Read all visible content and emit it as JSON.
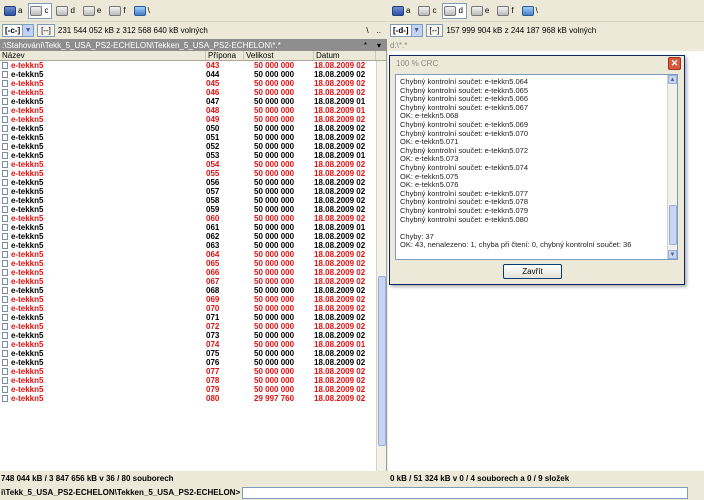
{
  "left": {
    "drives": [
      {
        "letter": "a",
        "type": "floppy"
      },
      {
        "letter": "c",
        "type": "hdd",
        "active": true
      },
      {
        "letter": "d",
        "type": "hdd"
      },
      {
        "letter": "e",
        "type": "hdd"
      },
      {
        "letter": "f",
        "type": "hdd"
      },
      {
        "letter": "\\",
        "type": "net"
      }
    ],
    "drive_combo": "[-c-]",
    "root_btn": "[--]",
    "free_space": "231 544 052 kB z 312 568 640 kB volných",
    "nav_back": "\\",
    "nav_up": "..",
    "path": ":\\Stahování\\Tekk_5_USA_PS2-ECHELON\\Tekken_5_USA_PS2-ECHELON\\*.*",
    "path_btn_star": "*",
    "path_btn_down": "▾",
    "columns": {
      "name": "Název",
      "ext": "Přípona",
      "size": "Velikost",
      "date": "Datum"
    },
    "rows": [
      {
        "name": "e-tekkn5",
        "ext": "043",
        "size": "50 000 000",
        "date": "18.08.2009 02",
        "color": "red"
      },
      {
        "name": "e-tekkn5",
        "ext": "044",
        "size": "50 000 000",
        "date": "18.08.2009 02",
        "color": "black"
      },
      {
        "name": "e-tekkn5",
        "ext": "045",
        "size": "50 000 000",
        "date": "18.08.2009 02",
        "color": "red"
      },
      {
        "name": "e-tekkn5",
        "ext": "046",
        "size": "50 000 000",
        "date": "18.08.2009 02",
        "color": "red"
      },
      {
        "name": "e-tekkn5",
        "ext": "047",
        "size": "50 000 000",
        "date": "18.08.2009 01",
        "color": "black"
      },
      {
        "name": "e-tekkn5",
        "ext": "048",
        "size": "50 000 000",
        "date": "18.08.2009 01",
        "color": "red"
      },
      {
        "name": "e-tekkn5",
        "ext": "049",
        "size": "50 000 000",
        "date": "18.08.2009 02",
        "color": "red"
      },
      {
        "name": "e-tekkn5",
        "ext": "050",
        "size": "50 000 000",
        "date": "18.08.2009 02",
        "color": "black"
      },
      {
        "name": "e-tekkn5",
        "ext": "051",
        "size": "50 000 000",
        "date": "18.08.2009 02",
        "color": "black"
      },
      {
        "name": "e-tekkn5",
        "ext": "052",
        "size": "50 000 000",
        "date": "18.08.2009 02",
        "color": "black"
      },
      {
        "name": "e-tekkn5",
        "ext": "053",
        "size": "50 000 000",
        "date": "18.08.2009 01",
        "color": "black"
      },
      {
        "name": "e-tekkn5",
        "ext": "054",
        "size": "50 000 000",
        "date": "18.08.2009 02",
        "color": "red"
      },
      {
        "name": "e-tekkn5",
        "ext": "055",
        "size": "50 000 000",
        "date": "18.08.2009 02",
        "color": "red"
      },
      {
        "name": "e-tekkn5",
        "ext": "056",
        "size": "50 000 000",
        "date": "18.08.2009 02",
        "color": "black"
      },
      {
        "name": "e-tekkn5",
        "ext": "057",
        "size": "50 000 000",
        "date": "18.08.2009 02",
        "color": "black"
      },
      {
        "name": "e-tekkn5",
        "ext": "058",
        "size": "50 000 000",
        "date": "18.08.2009 02",
        "color": "black"
      },
      {
        "name": "e-tekkn5",
        "ext": "059",
        "size": "50 000 000",
        "date": "18.08.2009 02",
        "color": "black"
      },
      {
        "name": "e-tekkn5",
        "ext": "060",
        "size": "50 000 000",
        "date": "18.08.2009 02",
        "color": "red"
      },
      {
        "name": "e-tekkn5",
        "ext": "061",
        "size": "50 000 000",
        "date": "18.08.2009 01",
        "color": "black"
      },
      {
        "name": "e-tekkn5",
        "ext": "062",
        "size": "50 000 000",
        "date": "18.08.2009 02",
        "color": "black"
      },
      {
        "name": "e-tekkn5",
        "ext": "063",
        "size": "50 000 000",
        "date": "18.08.2009 02",
        "color": "black"
      },
      {
        "name": "e-tekkn5",
        "ext": "064",
        "size": "50 000 000",
        "date": "18.08.2009 02",
        "color": "red"
      },
      {
        "name": "e-tekkn5",
        "ext": "065",
        "size": "50 000 000",
        "date": "18.08.2009 02",
        "color": "red"
      },
      {
        "name": "e-tekkn5",
        "ext": "066",
        "size": "50 000 000",
        "date": "18.08.2009 02",
        "color": "red"
      },
      {
        "name": "e-tekkn5",
        "ext": "067",
        "size": "50 000 000",
        "date": "18.08.2009 02",
        "color": "red"
      },
      {
        "name": "e-tekkn5",
        "ext": "068",
        "size": "50 000 000",
        "date": "18.08.2009 02",
        "color": "black"
      },
      {
        "name": "e-tekkn5",
        "ext": "069",
        "size": "50 000 000",
        "date": "18.08.2009 02",
        "color": "red"
      },
      {
        "name": "e-tekkn5",
        "ext": "070",
        "size": "50 000 000",
        "date": "18.08.2009 02",
        "color": "red"
      },
      {
        "name": "e-tekkn5",
        "ext": "071",
        "size": "50 000 000",
        "date": "18.08.2009 02",
        "color": "black"
      },
      {
        "name": "e-tekkn5",
        "ext": "072",
        "size": "50 000 000",
        "date": "18.08.2009 02",
        "color": "red"
      },
      {
        "name": "e-tekkn5",
        "ext": "073",
        "size": "50 000 000",
        "date": "18.08.2009 02",
        "color": "black"
      },
      {
        "name": "e-tekkn5",
        "ext": "074",
        "size": "50 000 000",
        "date": "18.08.2009 01",
        "color": "red"
      },
      {
        "name": "e-tekkn5",
        "ext": "075",
        "size": "50 000 000",
        "date": "18.08.2009 02",
        "color": "black"
      },
      {
        "name": "e-tekkn5",
        "ext": "076",
        "size": "50 000 000",
        "date": "18.08.2009 02",
        "color": "black"
      },
      {
        "name": "e-tekkn5",
        "ext": "077",
        "size": "50 000 000",
        "date": "18.08.2009 02",
        "color": "red"
      },
      {
        "name": "e-tekkn5",
        "ext": "078",
        "size": "50 000 000",
        "date": "18.08.2009 02",
        "color": "red"
      },
      {
        "name": "e-tekkn5",
        "ext": "079",
        "size": "50 000 000",
        "date": "18.08.2009 02",
        "color": "red"
      },
      {
        "name": "e-tekkn5",
        "ext": "080",
        "size": "29 997 760",
        "date": "18.08.2009 02",
        "color": "red"
      }
    ],
    "status": "748 044 kB / 3 847 656 kB v 36 / 80 souborech"
  },
  "right": {
    "drives": [
      {
        "letter": "a",
        "type": "floppy"
      },
      {
        "letter": "c",
        "type": "hdd"
      },
      {
        "letter": "d",
        "type": "hdd",
        "active": true
      },
      {
        "letter": "e",
        "type": "hdd"
      },
      {
        "letter": "f",
        "type": "hdd"
      },
      {
        "letter": "\\",
        "type": "net"
      }
    ],
    "drive_combo": "[-d-]",
    "root_btn": "[--]",
    "free_space": "157 999 904 kB z 244 187 968 kB volných",
    "path": "d:\\*.*",
    "status": "0 kB / 51 324 kB v 0 / 4 souborech a 0 / 9 složek"
  },
  "dialog": {
    "title": "100 % CRC",
    "close_glyph": "✕",
    "lines": [
      "Chybný kontrolní součet:  e-tekkn5.064",
      "Chybný kontrolní součet:  e-tekkn5.065",
      "Chybný kontrolní součet:  e-tekkn5.066",
      "Chybný kontrolní součet:  e-tekkn5.067",
      "OK:    e-tekkn5.068",
      "Chybný kontrolní součet:  e-tekkn5.069",
      "Chybný kontrolní součet:  e-tekkn5.070",
      "OK:    e-tekkn5.071",
      "Chybný kontrolní součet:  e-tekkn5.072",
      "OK:    e-tekkn5.073",
      "Chybný kontrolní součet:  e-tekkn5.074",
      "OK:    e-tekkn5.075",
      "OK:    e-tekkn5.076",
      "Chybný kontrolní součet:  e-tekkn5.077",
      "Chybný kontrolní součet:  e-tekkn5.078",
      "Chybný kontrolní součet:  e-tekkn5.079",
      "Chybný kontrolní součet:  e-tekkn5.080",
      "",
      "Chyby: 37",
      "OK: 43, nenalezeno: 1, chyba při čtení: 0, chybný kontrolní součet: 36"
    ],
    "close_button": "Zavřít"
  },
  "cmdline": {
    "prompt": "i\\Tekk_5_USA_PS2-ECHELON\\Tekken_5_USA_PS2-ECHELON>"
  },
  "colors": {
    "red": "#e01010",
    "black": "#000000",
    "path_bg": "#8e8e8e"
  }
}
